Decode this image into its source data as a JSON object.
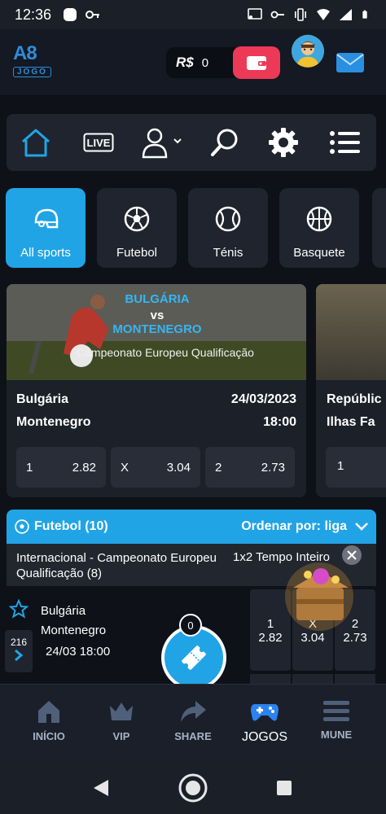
{
  "status_bar": {
    "time": "12:36"
  },
  "header": {
    "logo_brand": "A8",
    "logo_sub": "JOGO",
    "currency": "R$",
    "balance": "0",
    "icons": [
      "wallet-icon",
      "avatar",
      "mail-icon"
    ]
  },
  "nav": {
    "items": [
      {
        "name": "home-icon"
      },
      {
        "name": "live-icon",
        "label": "LIVE"
      },
      {
        "name": "user-icon"
      },
      {
        "name": "search-icon"
      },
      {
        "name": "gear-icon"
      },
      {
        "name": "menu-icon"
      }
    ],
    "accent": "#21a4e6"
  },
  "sports": [
    {
      "label": "All sports",
      "icon": "helmet-icon",
      "active": true
    },
    {
      "label": "Futebol",
      "icon": "soccer-ball-icon"
    },
    {
      "label": "Ténis",
      "icon": "tennis-ball-icon"
    },
    {
      "label": "Basquete",
      "icon": "basketball-icon"
    }
  ],
  "featured": {
    "team1_banner": "BULGÁRIA",
    "vs": "vs",
    "team2_banner": "MONTENEGRO",
    "competition": "Campeonato Europeu Qualificação",
    "team1": "Bulgária",
    "team2": "Montenegro",
    "date": "24/03/2023",
    "time": "18:00",
    "odds": [
      {
        "label": "1",
        "value": "2.82"
      },
      {
        "label": "X",
        "value": "3.04"
      },
      {
        "label": "2",
        "value": "2.73"
      }
    ]
  },
  "featured2": {
    "team1": "Repúblic",
    "team2": "Ilhas Fa",
    "odd_label": "1"
  },
  "futebol_section": {
    "title": "Futebol (10)",
    "sort_label": "Ordenar por: liga",
    "league": "Internacional - Campeonato Europeu Qualificação (8)",
    "market": "1x2 Tempo Inteiro",
    "match": {
      "team1": "Bulgária",
      "team2": "Montenegro",
      "datetime": "24/03 18:00",
      "markets_count": "216",
      "odds": [
        {
          "label": "1",
          "value": "2.82"
        },
        {
          "label": "X",
          "value": "3.04"
        },
        {
          "label": "2",
          "value": "2.73"
        }
      ]
    }
  },
  "bet_slip": {
    "count": "0"
  },
  "bottom_nav": [
    {
      "label": "INÍCIO",
      "icon": "house-icon"
    },
    {
      "label": "VIP",
      "icon": "crown-icon"
    },
    {
      "label": "SHARE",
      "icon": "share-icon"
    },
    {
      "label": "JOGOS",
      "icon": "gamepad-icon",
      "active": true
    },
    {
      "label": "MUNE",
      "icon": "menu-lines-icon"
    }
  ]
}
